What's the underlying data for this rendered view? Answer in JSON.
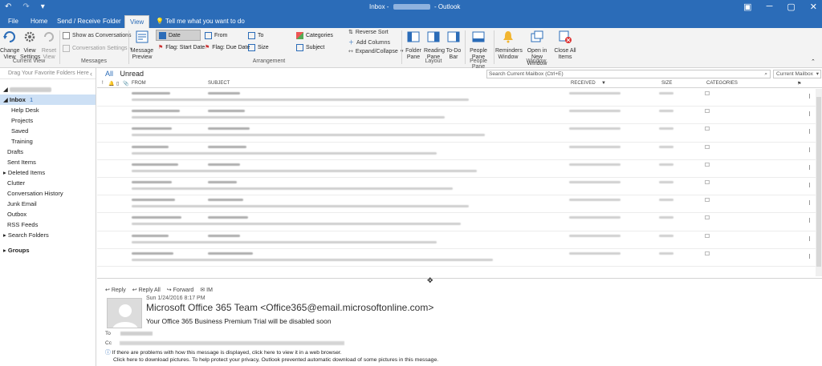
{
  "titlebar": {
    "prefix": "Inbox -",
    "suffix": "- Outlook"
  },
  "tabs": [
    "File",
    "Home",
    "Send / Receive",
    "Folder",
    "View",
    "Tell me what you want to do"
  ],
  "ribbon": {
    "current_view": {
      "change_view": "Change View",
      "view_settings": "View Settings",
      "reset_view": "Reset View",
      "group": "Current View"
    },
    "messages": {
      "show_as_conversations": "Show as Conversations",
      "conversation_settings": "Conversation Settings",
      "group": "Messages"
    },
    "arrangement": {
      "message_preview": "Message Preview",
      "date": "Date",
      "from": "From",
      "to": "To",
      "categories": "Categories",
      "flag_start": "Flag: Start Date",
      "flag_due": "Flag: Due Date",
      "size": "Size",
      "subject": "Subject",
      "reverse_sort": "Reverse Sort",
      "add_columns": "Add Columns",
      "expand_collapse": "Expand/Collapse",
      "group": "Arrangement"
    },
    "layout": {
      "folder_pane": "Folder Pane",
      "reading_pane": "Reading Pane",
      "todo_bar": "To-Do Bar",
      "group": "Layout"
    },
    "people_pane": {
      "people_pane": "People Pane",
      "group": "People Pane"
    },
    "window": {
      "reminders": "Reminders Window",
      "open_new": "Open in New Window",
      "close_all": "Close All Items",
      "group": "Window"
    }
  },
  "sidebar": {
    "favorites_hint": "Drag Your Favorite Folders Here",
    "inbox_label": "Inbox",
    "inbox_count": "1",
    "subfolders": [
      "Help Desk",
      "Projects",
      "Saved",
      "Training"
    ],
    "folders": [
      "Drafts",
      "Sent Items",
      "Deleted Items",
      "Clutter",
      "Conversation History",
      "Junk Email",
      "Outbox",
      "RSS Feeds",
      "Search Folders"
    ],
    "groups": "Groups"
  },
  "list": {
    "filter_all": "All",
    "filter_unread": "Unread",
    "search_placeholder": "Search Current Mailbox (Ctrl+E)",
    "mailbox_scope": "Current Mailbox",
    "headers": {
      "from": "FROM",
      "subject": "SUBJECT",
      "received": "RECEIVED",
      "size": "SIZE",
      "categories": "CATEGORIES"
    }
  },
  "reading": {
    "reply": "Reply",
    "reply_all": "Reply All",
    "forward": "Forward",
    "im": "IM",
    "date": "Sun 1/24/2016 8:17 PM",
    "sender": "Microsoft Office 365 Team <Office365@email.microsoftonline.com>",
    "subject": "Your Office 365 Business Premium Trial will be disabled soon",
    "to_label": "To",
    "cc_label": "Cc",
    "info_line1": "If there are problems with how this message is displayed, click here to view it in a web browser.",
    "info_line2": "Click here to download pictures. To help protect your privacy, Outlook prevented automatic download of some pictures in this message."
  },
  "colors": {
    "accent": "#2b6cb8",
    "selected": "#cde0f5"
  }
}
